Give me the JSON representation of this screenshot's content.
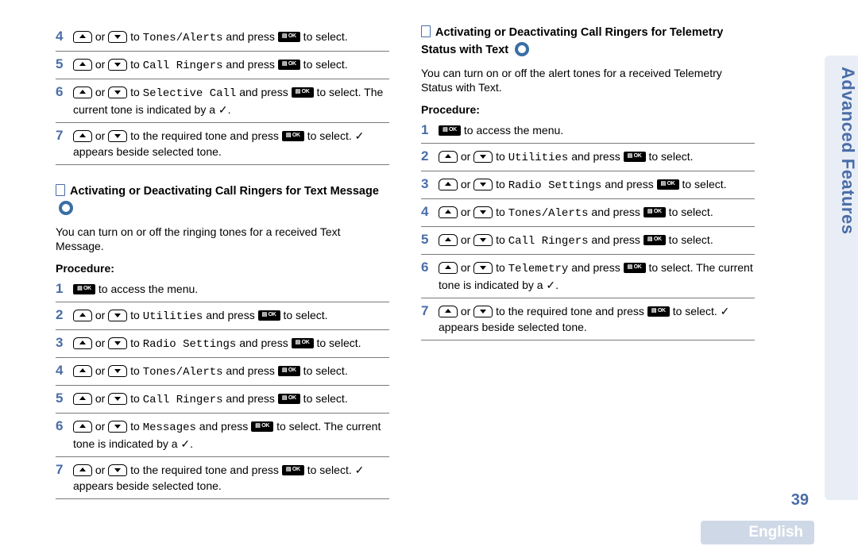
{
  "sideTab": "Advanced Features",
  "pageNum": "39",
  "language": "English",
  "checkGlyph": "✓",
  "or": " or ",
  "to": " to ",
  "andPress": " and press ",
  "toSelect": " to select.",
  "toSelectThe": " to select. The current tone is indicated by a ",
  "period": ".",
  "accessMenu": " to access the menu.",
  "reqTonePre": " to the required tone and press ",
  "reqTonePost": " to select. ",
  "appearsBeside": " appears beside selected tone.",
  "okLabel": "▤ OK",
  "colA": {
    "topSteps": [
      {
        "n": "4",
        "dest": "Tones/Alerts"
      },
      {
        "n": "5",
        "dest": "Call Ringers"
      },
      {
        "n": "6",
        "dest": "Selective Call",
        "withCheckTail": true
      },
      {
        "n": "7",
        "isFinal": true
      }
    ],
    "sec": {
      "title": "Activating or Deactivating Call Ringers for Text Message",
      "intro": "You can turn on or off the ringing tones for a received Text Message.",
      "procLabel": "Procedure:",
      "steps": [
        {
          "n": "1",
          "isAccess": true
        },
        {
          "n": "2",
          "dest": "Utilities"
        },
        {
          "n": "3",
          "dest": "Radio Settings"
        },
        {
          "n": "4",
          "dest": "Tones/Alerts"
        },
        {
          "n": "5",
          "dest": "Call Ringers"
        },
        {
          "n": "6",
          "dest": "Messages",
          "withCheckTail": true
        },
        {
          "n": "7",
          "isFinal": true
        }
      ]
    }
  },
  "colB": {
    "sec": {
      "title": "Activating or Deactivating Call Ringers for Telemetry Status with Text",
      "intro": "You can turn on or off the alert tones for a received Telemetry Status with Text.",
      "procLabel": "Procedure:",
      "steps": [
        {
          "n": "1",
          "isAccess": true
        },
        {
          "n": "2",
          "dest": "Utilities"
        },
        {
          "n": "3",
          "dest": "Radio Settings"
        },
        {
          "n": "4",
          "dest": "Tones/Alerts"
        },
        {
          "n": "5",
          "dest": "Call Ringers"
        },
        {
          "n": "6",
          "dest": "Telemetry",
          "withCheckTail": true
        },
        {
          "n": "7",
          "isFinal": true
        }
      ]
    }
  }
}
